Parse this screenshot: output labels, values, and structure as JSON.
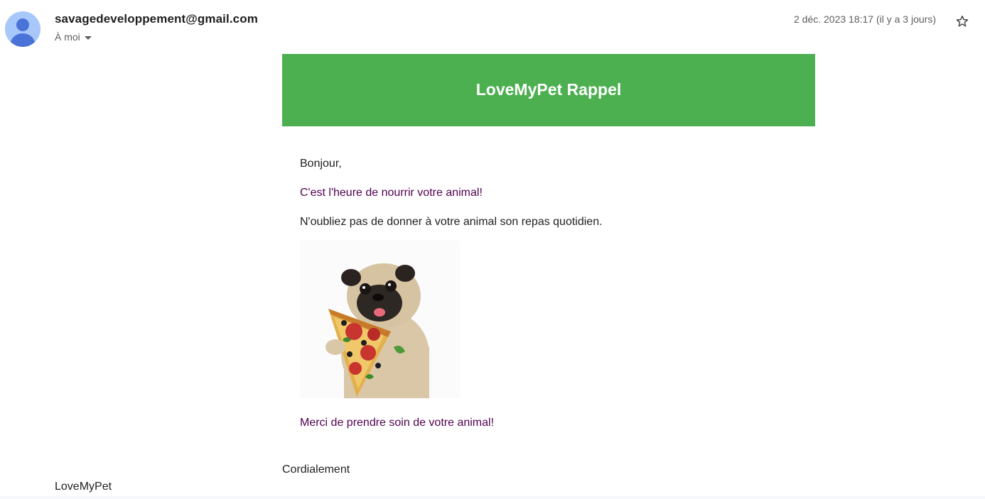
{
  "header": {
    "sender": "savagedeveloppement@gmail.com",
    "recipient_label": "À moi",
    "date": "2 déc. 2023 18:17 (il y a 3 jours)",
    "avatar_icon": "person-icon",
    "star_icon": "star-outline-icon"
  },
  "email": {
    "banner_title": "LoveMyPet Rappel",
    "banner_color": "#4caf50",
    "greeting": "Bonjour,",
    "headline": "C'est l'heure de nourrir votre animal!",
    "reminder": "N'oubliez pas de donner à votre animal son repas quotidien.",
    "image_subject": "pug-holding-pizza-image",
    "thanks": "Merci de prendre soin de votre animal!",
    "closing": "Cordialement",
    "signature": "LoveMyPet",
    "link_color": "#500050"
  }
}
